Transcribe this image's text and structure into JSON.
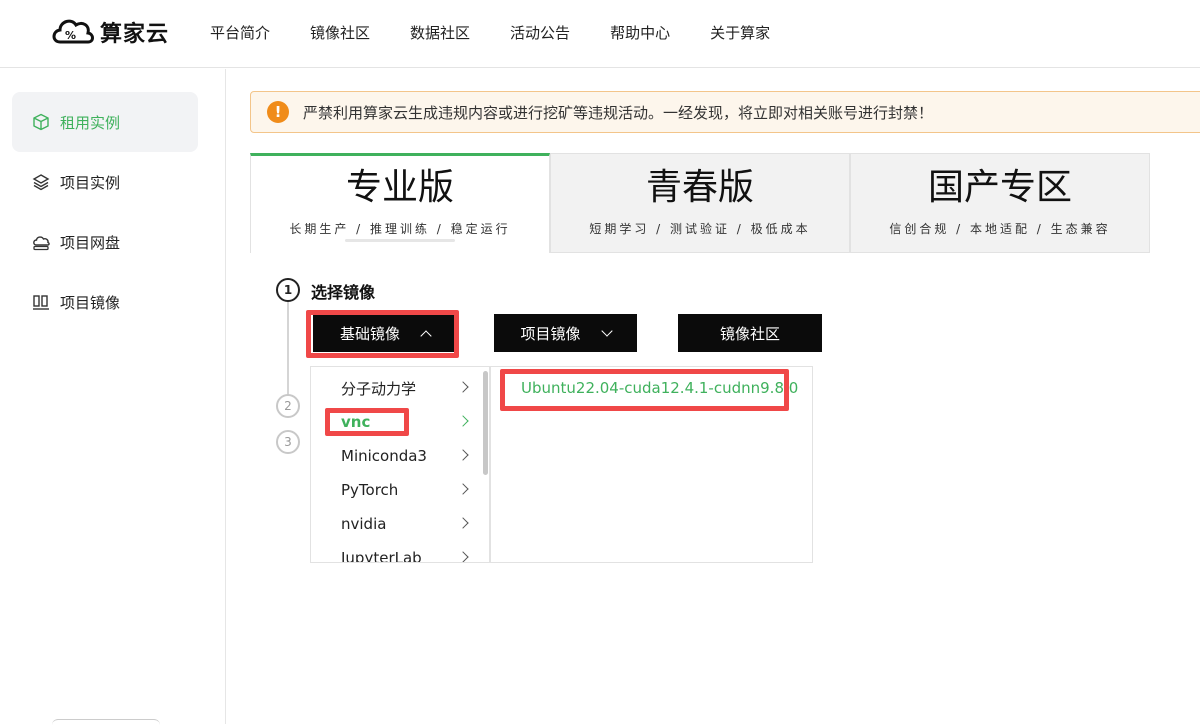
{
  "header": {
    "brand": "算家云",
    "nav": [
      "平台简介",
      "镜像社区",
      "数据社区",
      "活动公告",
      "帮助中心",
      "关于算家"
    ]
  },
  "sidebar": {
    "items": [
      {
        "label": "租用实例",
        "icon": "cube-icon",
        "active": true
      },
      {
        "label": "项目实例",
        "icon": "layers-icon",
        "active": false
      },
      {
        "label": "项目网盘",
        "icon": "cloud-drive-icon",
        "active": false
      },
      {
        "label": "项目镜像",
        "icon": "image-grid-icon",
        "active": false
      }
    ]
  },
  "notice": {
    "icon": "!",
    "text": "严禁利用算家云生成违规内容或进行挖矿等违规活动。一经发现，将立即对相关账号进行封禁！"
  },
  "editions": [
    {
      "title": "专业版",
      "subtitle": "长期生产 / 推理训练 / 稳定运行",
      "active": true
    },
    {
      "title": "青春版",
      "subtitle": "短期学习 / 测试验证 / 极低成本",
      "active": false
    },
    {
      "title": "国产专区",
      "subtitle": "信创合规 / 本地适配 / 生态兼容",
      "active": false
    }
  ],
  "steps": {
    "step1": {
      "number": "1",
      "label": "选择镜像"
    },
    "step2": {
      "number": "2"
    },
    "step3": {
      "number": "3"
    }
  },
  "mirror_buttons": {
    "base": "基础镜像",
    "project": "项目镜像",
    "community": "镜像社区"
  },
  "categories": [
    "分子动力学",
    "vnc",
    "Miniconda3",
    "PyTorch",
    "nvidia",
    "JupyterLab"
  ],
  "selected_category": "vnc",
  "versions": [
    "Ubuntu22.04-cuda12.4.1-cudnn9.8.0"
  ],
  "colors": {
    "accent": "#3fb15c",
    "highlight": "#f04848",
    "warning": "#f08c1a"
  }
}
